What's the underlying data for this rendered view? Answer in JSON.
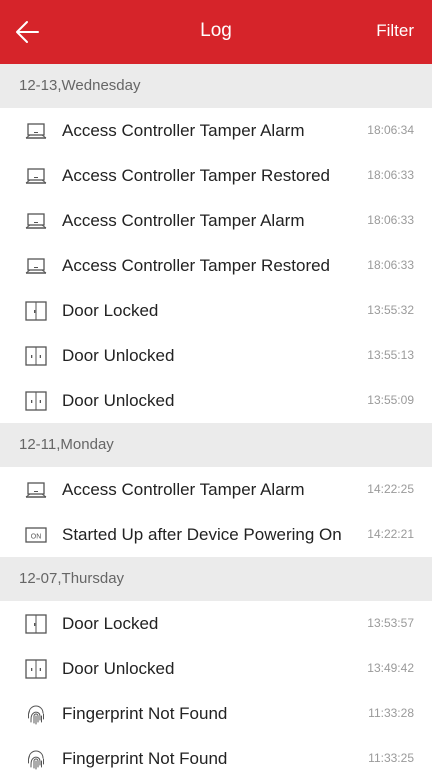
{
  "header": {
    "title": "Log",
    "filter_label": "Filter",
    "back_icon": "arrow-left-icon",
    "color": "#d6242a"
  },
  "sections": [
    {
      "date": "12-13,Wednesday",
      "items": [
        {
          "icon": "laptop-icon",
          "label": "Access Controller Tamper Alarm",
          "time": "18:06:34"
        },
        {
          "icon": "laptop-icon",
          "label": "Access Controller Tamper Restored",
          "time": "18:06:33"
        },
        {
          "icon": "laptop-icon",
          "label": "Access Controller Tamper Alarm",
          "time": "18:06:33"
        },
        {
          "icon": "laptop-icon",
          "label": "Access Controller Tamper Restored",
          "time": "18:06:33"
        },
        {
          "icon": "door-locked-icon",
          "label": "Door Locked",
          "time": "13:55:32"
        },
        {
          "icon": "door-unlocked-icon",
          "label": "Door Unlocked",
          "time": "13:55:13"
        },
        {
          "icon": "door-unlocked-icon",
          "label": "Door Unlocked",
          "time": "13:55:09"
        }
      ]
    },
    {
      "date": "12-11,Monday",
      "items": [
        {
          "icon": "laptop-icon",
          "label": "Access Controller Tamper Alarm",
          "time": "14:22:25"
        },
        {
          "icon": "power-on-icon",
          "label": "Started Up after Device Powering On",
          "time": "14:22:21",
          "badge": "ON"
        }
      ]
    },
    {
      "date": "12-07,Thursday",
      "items": [
        {
          "icon": "door-locked-icon",
          "label": "Door Locked",
          "time": "13:53:57"
        },
        {
          "icon": "door-unlocked-icon",
          "label": "Door Unlocked",
          "time": "13:49:42"
        },
        {
          "icon": "fingerprint-icon",
          "label": "Fingerprint Not Found",
          "time": "11:33:28"
        },
        {
          "icon": "fingerprint-icon",
          "label": "Fingerprint Not Found",
          "time": "11:33:25"
        }
      ]
    }
  ]
}
